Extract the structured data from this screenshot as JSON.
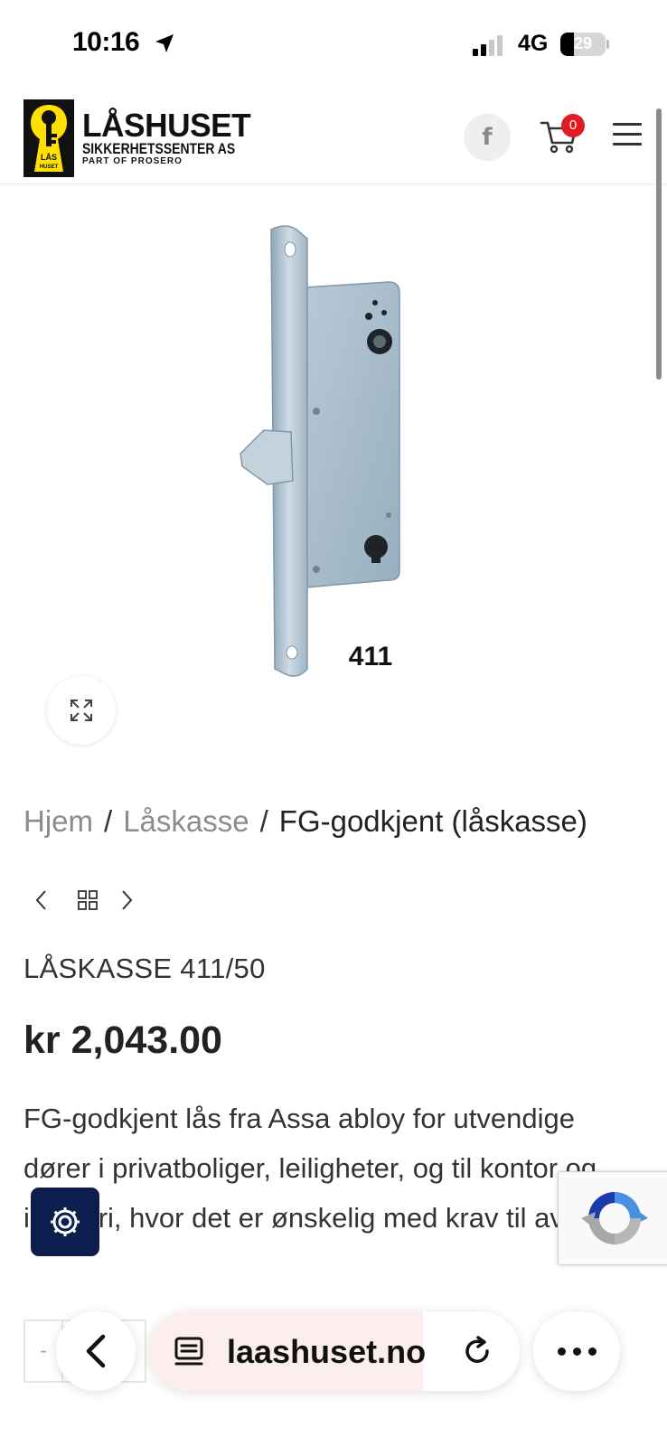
{
  "status_bar": {
    "time": "10:16",
    "network": "4G",
    "battery": "29",
    "battery_level": 0.29,
    "icons": [
      "location-arrow-icon",
      "cellular-signal-icon",
      "battery-icon"
    ]
  },
  "header": {
    "logo": {
      "name": "LÅSHUSET",
      "subtitle": "SIKKERHETSSENTER AS",
      "tagline": "PART OF PROSERO",
      "mark_text": "LÅS HUSET"
    },
    "facebook_label": "f",
    "cart_count": "0",
    "icons": [
      "facebook-icon",
      "cart-icon",
      "hamburger-menu-icon"
    ]
  },
  "product_image": {
    "label": "411"
  },
  "breadcrumb": {
    "items": [
      "Hjem",
      "Låskasse"
    ],
    "separator": "/",
    "current": "FG-godkjent (låskasse)"
  },
  "product": {
    "title": "LÅSKASSE 411/50",
    "price": "kr 2,043.00",
    "description": "FG-godkjent lås fra Assa abloy for utvendige dører i privatboliger, leiligheter, og til kontor og industri, hvor det er ønskelig med krav til avlåsing.",
    "quantity_minus": "-"
  },
  "browser": {
    "url": "laashuset.no",
    "load_progress": 0.74
  },
  "colors": {
    "brand_yellow": "#ffe000",
    "brand_black": "#111111",
    "badge_red": "#e21a23",
    "settings_navy": "#0b1e4f",
    "muted_link": "#8c8c8c"
  }
}
